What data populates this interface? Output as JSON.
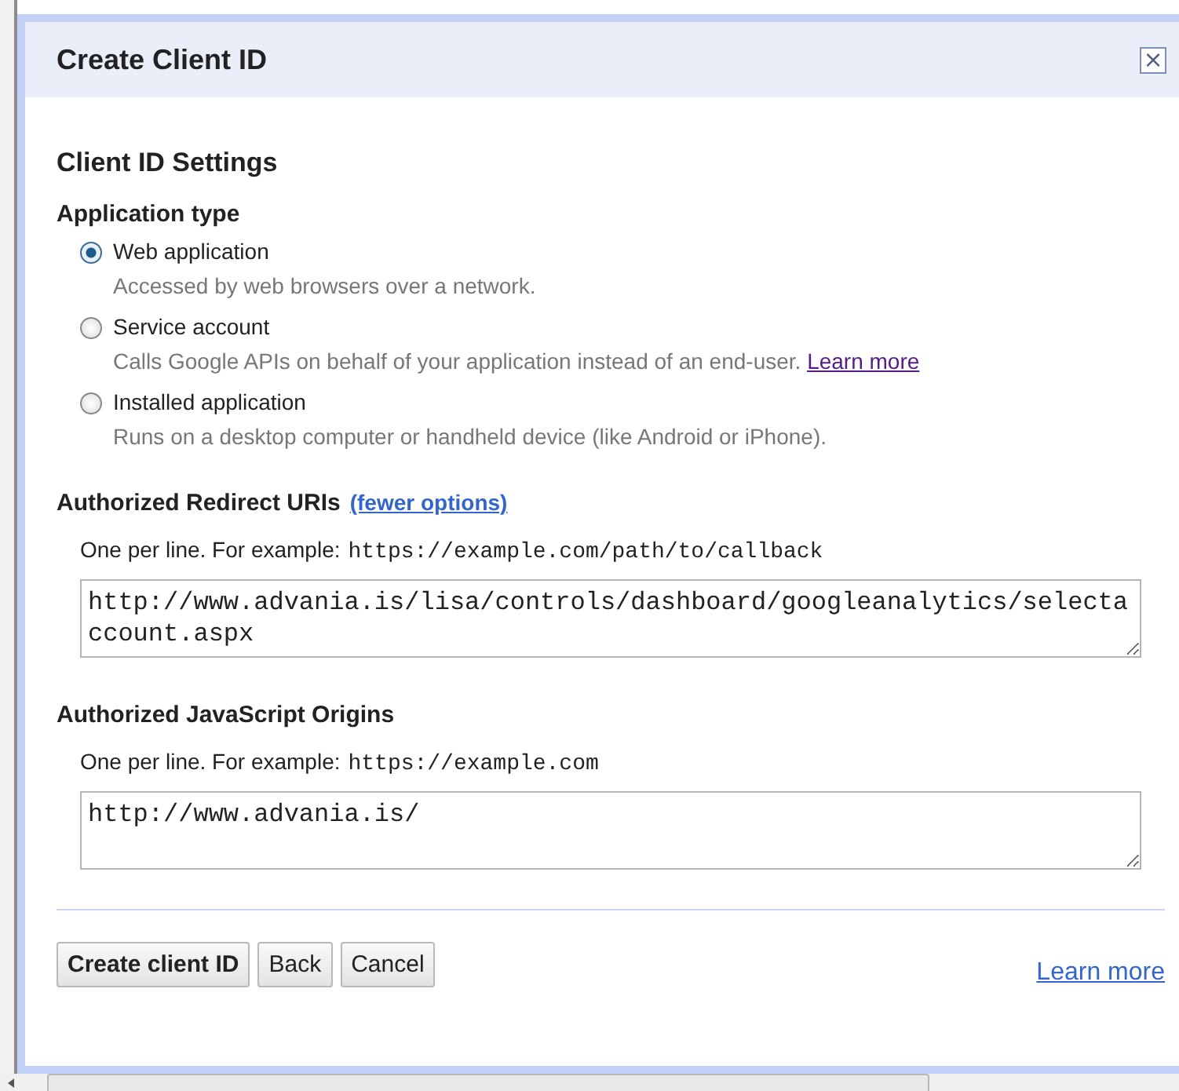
{
  "dialog": {
    "title": "Create Client ID",
    "close": "×"
  },
  "section_title": "Client ID Settings",
  "application_type": {
    "label": "Application type",
    "options": [
      {
        "label": "Web application",
        "description": "Accessed by web browsers over a network.",
        "selected": true
      },
      {
        "label": "Service account",
        "description": "Calls Google APIs on behalf of your application instead of an end-user.",
        "link": "Learn more",
        "selected": false
      },
      {
        "label": "Installed application",
        "description": "Runs on a desktop computer or handheld device (like Android or iPhone).",
        "selected": false
      }
    ]
  },
  "redirect_uris": {
    "label": "Authorized Redirect URIs",
    "toggle_link": "(fewer options)",
    "hint": "One per line. For example:",
    "example": "https://example.com/path/to/callback",
    "value": "http://www.advania.is/lisa/controls/dashboard/googleanalytics/selectaccount.aspx"
  },
  "javascript_origins": {
    "label": "Authorized JavaScript Origins",
    "hint": "One per line. For example:",
    "example": "https://example.com",
    "value": "http://www.advania.is/"
  },
  "buttons": [
    {
      "label": "Create client ID",
      "kind": "primary"
    },
    {
      "label": "Back",
      "kind": "normal"
    },
    {
      "label": "Cancel",
      "kind": "normal"
    }
  ],
  "footer_link": "Learn more"
}
